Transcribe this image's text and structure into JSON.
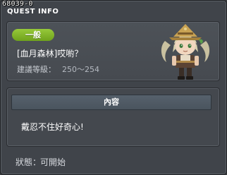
{
  "window": {
    "quest_id": "68039-0",
    "title": "QUEST INFO"
  },
  "quest": {
    "category": "一般",
    "category_color": "#7fb22a",
    "title": "[血月森林]哎喲？",
    "level_label": "建議等級：",
    "level_range": "250～254"
  },
  "content": {
    "header": "內容",
    "text": "戴忍不住好奇心!"
  },
  "status": {
    "label": "狀態：",
    "value": "可開始"
  },
  "npc": {
    "icon": "npc-portrait-icon"
  }
}
